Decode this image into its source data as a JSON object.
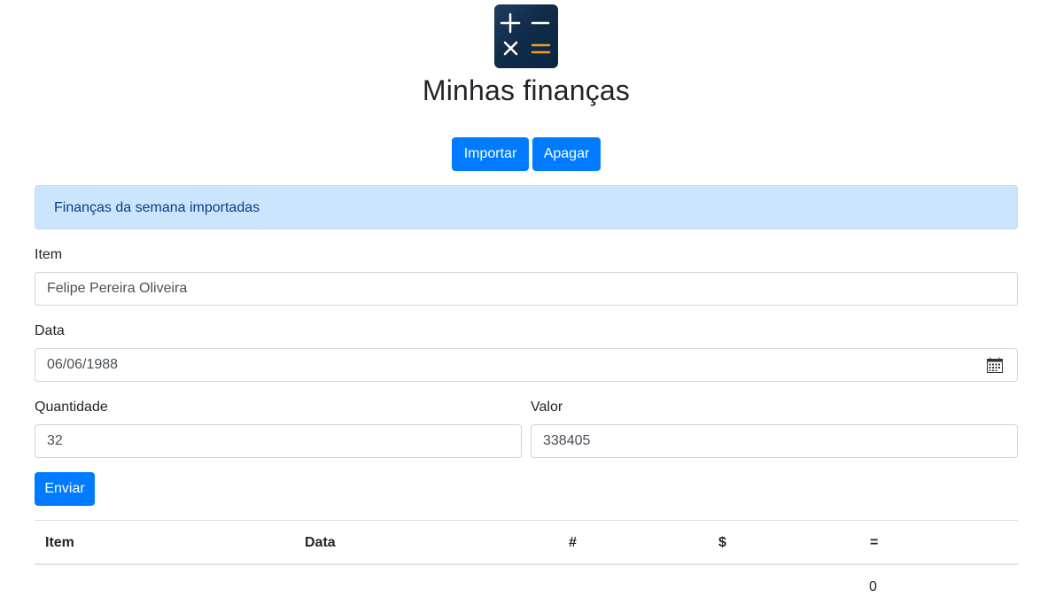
{
  "header": {
    "logo_icon": "calculator-icon",
    "title": "Minhas finanças"
  },
  "actions": {
    "import_label": "Importar",
    "delete_label": "Apagar"
  },
  "alert": {
    "message": "Finanças da semana importadas",
    "type": "info"
  },
  "form": {
    "item": {
      "label": "Item",
      "value": "Felipe Pereira Oliveira"
    },
    "data": {
      "label": "Data",
      "value": "06/06/1988"
    },
    "quantidade": {
      "label": "Quantidade",
      "value": "32"
    },
    "valor": {
      "label": "Valor",
      "value": "338405"
    },
    "submit_label": "Enviar"
  },
  "table": {
    "columns": [
      "Item",
      "Data",
      "#",
      "$",
      "="
    ],
    "total_row": {
      "total": "0"
    }
  },
  "colors": {
    "primary": "#007bff",
    "alert_bg": "#cce5ff",
    "alert_text": "#004085"
  }
}
